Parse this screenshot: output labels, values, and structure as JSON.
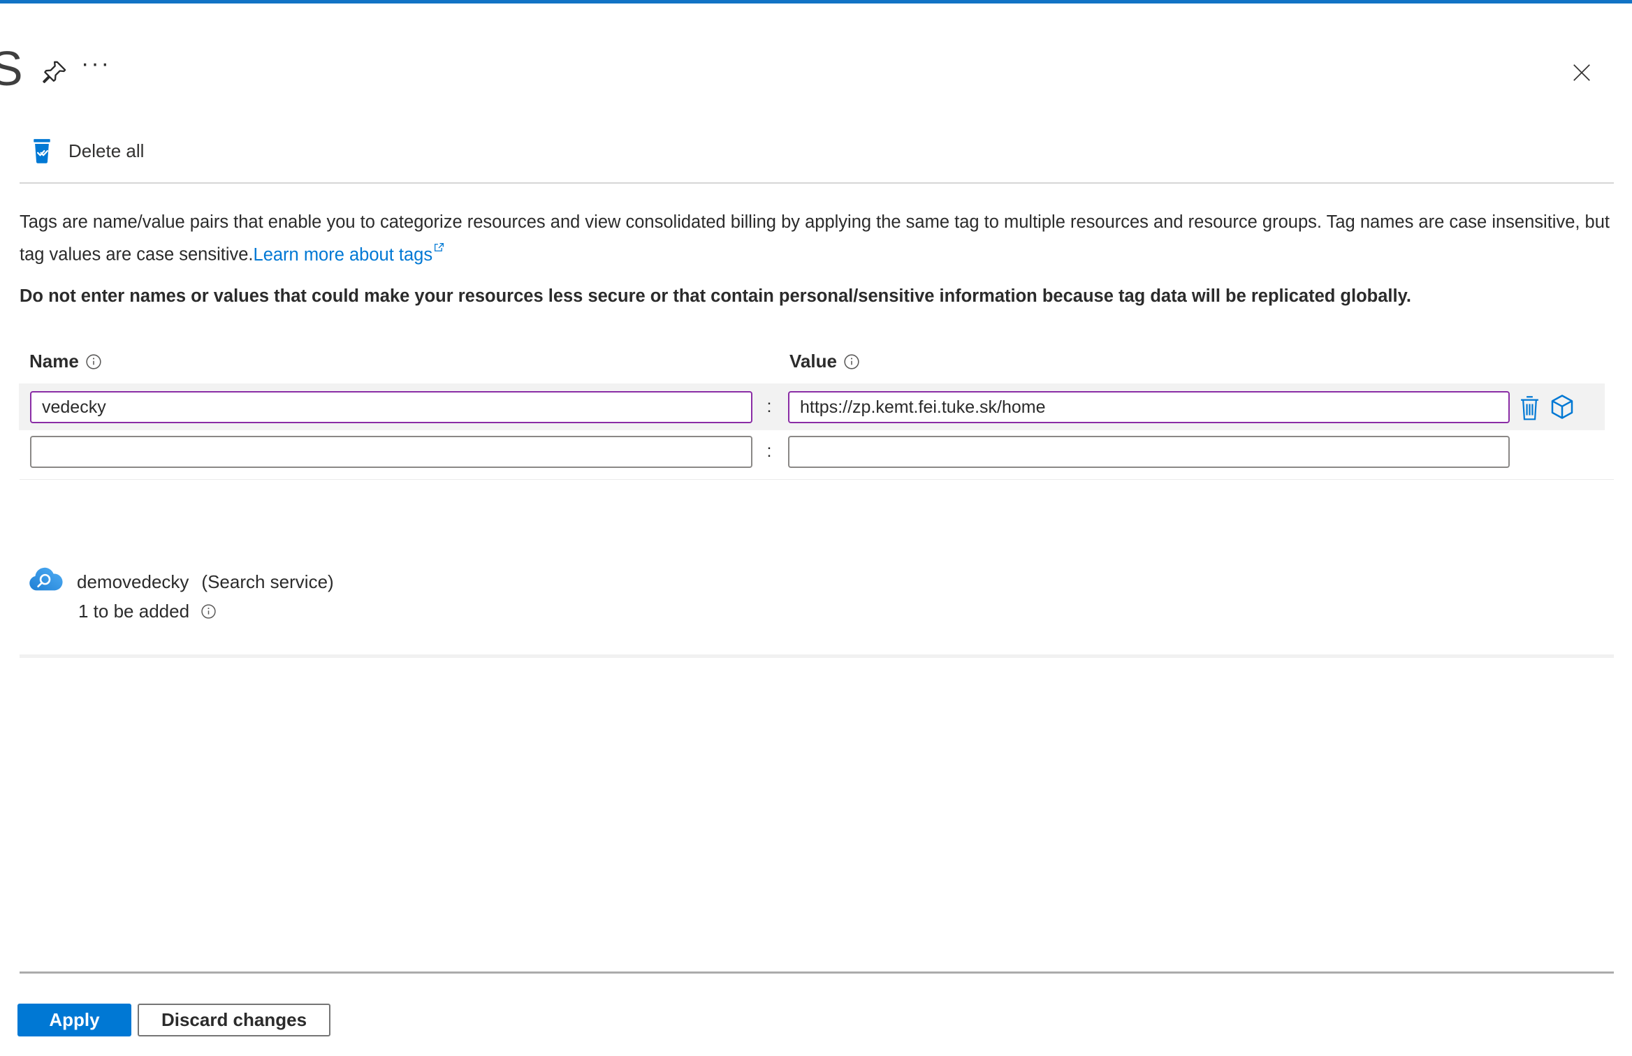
{
  "colors": {
    "top_bar": "#1173c5",
    "accent_blue": "#0078d4",
    "modified_purple": "#8a2da5",
    "row_highlight": "#f2f2f2"
  },
  "header": {
    "title_partial": "S",
    "more_label": "···"
  },
  "toolbar": {
    "delete_all_label": "Delete all"
  },
  "intro": {
    "description": "Tags are name/value pairs that enable you to categorize resources and view consolidated billing by applying the same tag to multiple resources and resource groups. Tag names are case insensitive, but tag values are case sensitive.",
    "learn_more_label": "Learn more about tags",
    "warning": "Do not enter names or values that could make your resources less secure or that contain personal/sensitive information because tag data will be replicated globally."
  },
  "tags_table": {
    "name_header": "Name",
    "value_header": "Value",
    "separator": ":",
    "rows": [
      {
        "name": "vedecky",
        "value": "https://zp.kemt.fei.tuke.sk/home"
      },
      {
        "name": "",
        "value": ""
      }
    ]
  },
  "resource": {
    "name": "demovedecky",
    "type_label": "(Search service)",
    "pending_label": "1 to be added"
  },
  "footer": {
    "apply_label": "Apply",
    "discard_label": "Discard changes"
  },
  "icons": {
    "pin": "pin-icon",
    "more": "more-icon",
    "close": "close-icon",
    "delete_all": "delete-all-trash-check-icon",
    "info": "info-icon",
    "external_link": "external-link-icon",
    "trash": "trash-icon",
    "cube": "cube-icon",
    "search_service": "search-service-cloud-icon"
  }
}
